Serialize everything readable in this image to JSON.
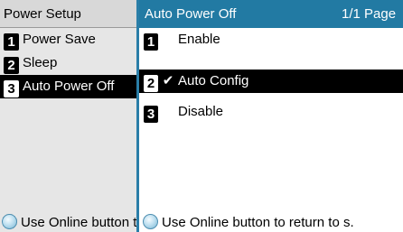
{
  "left_panel": {
    "title": "Power Setup",
    "items": [
      {
        "number": "1",
        "label": "Power Save"
      },
      {
        "number": "2",
        "label": "Sleep"
      },
      {
        "number": "3",
        "label": "Auto Power Off"
      }
    ],
    "selected_index": 2,
    "footer_text": "Use Online button to return to s."
  },
  "right_panel": {
    "title": "Auto Power Off",
    "page_indicator": "1/1 Page",
    "items": [
      {
        "number": "1",
        "label": "Enable"
      },
      {
        "number": "2",
        "label": "Auto Config"
      },
      {
        "number": "3",
        "label": "Disable"
      }
    ],
    "selected_index": 1,
    "checked_label": "Auto Config",
    "footer_text": "Use Online button to return to s."
  },
  "icons": {
    "check": "check-icon",
    "online": "online-button-icon"
  },
  "colors": {
    "header_blue": "#227aa3",
    "divider_blue": "#2a7ea8",
    "selection_black": "#000000"
  }
}
